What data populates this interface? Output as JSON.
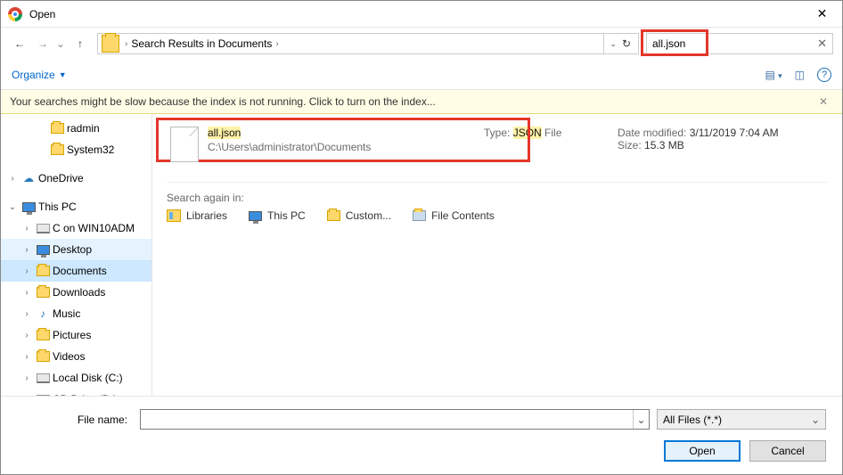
{
  "titlebar": {
    "title": "Open"
  },
  "breadcrumb": {
    "path": "Search Results in Documents"
  },
  "search": {
    "value": "all.json"
  },
  "toolbar": {
    "organize": "Organize"
  },
  "infobar": {
    "message": "Your searches might be slow because the index is not running.  Click to turn on the index..."
  },
  "tree": {
    "items": [
      {
        "label": "radmin",
        "indent": 2,
        "twisty": "",
        "icon": "folder",
        "sel": "",
        "hl": ""
      },
      {
        "label": "System32",
        "indent": 2,
        "twisty": "",
        "icon": "folder",
        "sel": "",
        "hl": ""
      },
      {
        "label": "",
        "indent": 0,
        "twisty": "",
        "icon": "",
        "sel": "",
        "hl": ""
      },
      {
        "label": "OneDrive",
        "indent": 0,
        "twisty": "›",
        "icon": "cloud",
        "sel": "",
        "hl": ""
      },
      {
        "label": "",
        "indent": 0,
        "twisty": "",
        "icon": "",
        "sel": "",
        "hl": ""
      },
      {
        "label": "This PC",
        "indent": 0,
        "twisty": "⌄",
        "icon": "monitor",
        "sel": "",
        "hl": ""
      },
      {
        "label": "C on WIN10ADM",
        "indent": 1,
        "twisty": "›",
        "icon": "drive",
        "sel": "",
        "hl": ""
      },
      {
        "label": "Desktop",
        "indent": 1,
        "twisty": "›",
        "icon": "monitor",
        "sel": "",
        "hl": "hl"
      },
      {
        "label": "Documents",
        "indent": 1,
        "twisty": "›",
        "icon": "folder",
        "sel": "sel",
        "hl": ""
      },
      {
        "label": "Downloads",
        "indent": 1,
        "twisty": "›",
        "icon": "folder",
        "sel": "",
        "hl": ""
      },
      {
        "label": "Music",
        "indent": 1,
        "twisty": "›",
        "icon": "music",
        "sel": "",
        "hl": ""
      },
      {
        "label": "Pictures",
        "indent": 1,
        "twisty": "›",
        "icon": "folder",
        "sel": "",
        "hl": ""
      },
      {
        "label": "Videos",
        "indent": 1,
        "twisty": "›",
        "icon": "folder",
        "sel": "",
        "hl": ""
      },
      {
        "label": "Local Disk (C:)",
        "indent": 1,
        "twisty": "›",
        "icon": "drive",
        "sel": "",
        "hl": ""
      },
      {
        "label": "CD Drive (D:)",
        "indent": 1,
        "twisty": "›",
        "icon": "drive",
        "sel": "",
        "hl": ""
      }
    ]
  },
  "result": {
    "name_match": "all.json",
    "path": "C:\\Users\\administrator\\Documents",
    "type_label": "Type:",
    "type_match": "JSON",
    "type_suffix": " File",
    "date_label": "Date modified:",
    "date_value": "3/11/2019 7:04 AM",
    "size_label": "Size:",
    "size_value": "15.3 MB"
  },
  "search_again": {
    "title": "Search again in:",
    "items": [
      "Libraries",
      "This PC",
      "Custom...",
      "File Contents"
    ]
  },
  "footer": {
    "filename_label": "File name:",
    "filter": "All Files (*.*)",
    "open": "Open",
    "cancel": "Cancel"
  }
}
